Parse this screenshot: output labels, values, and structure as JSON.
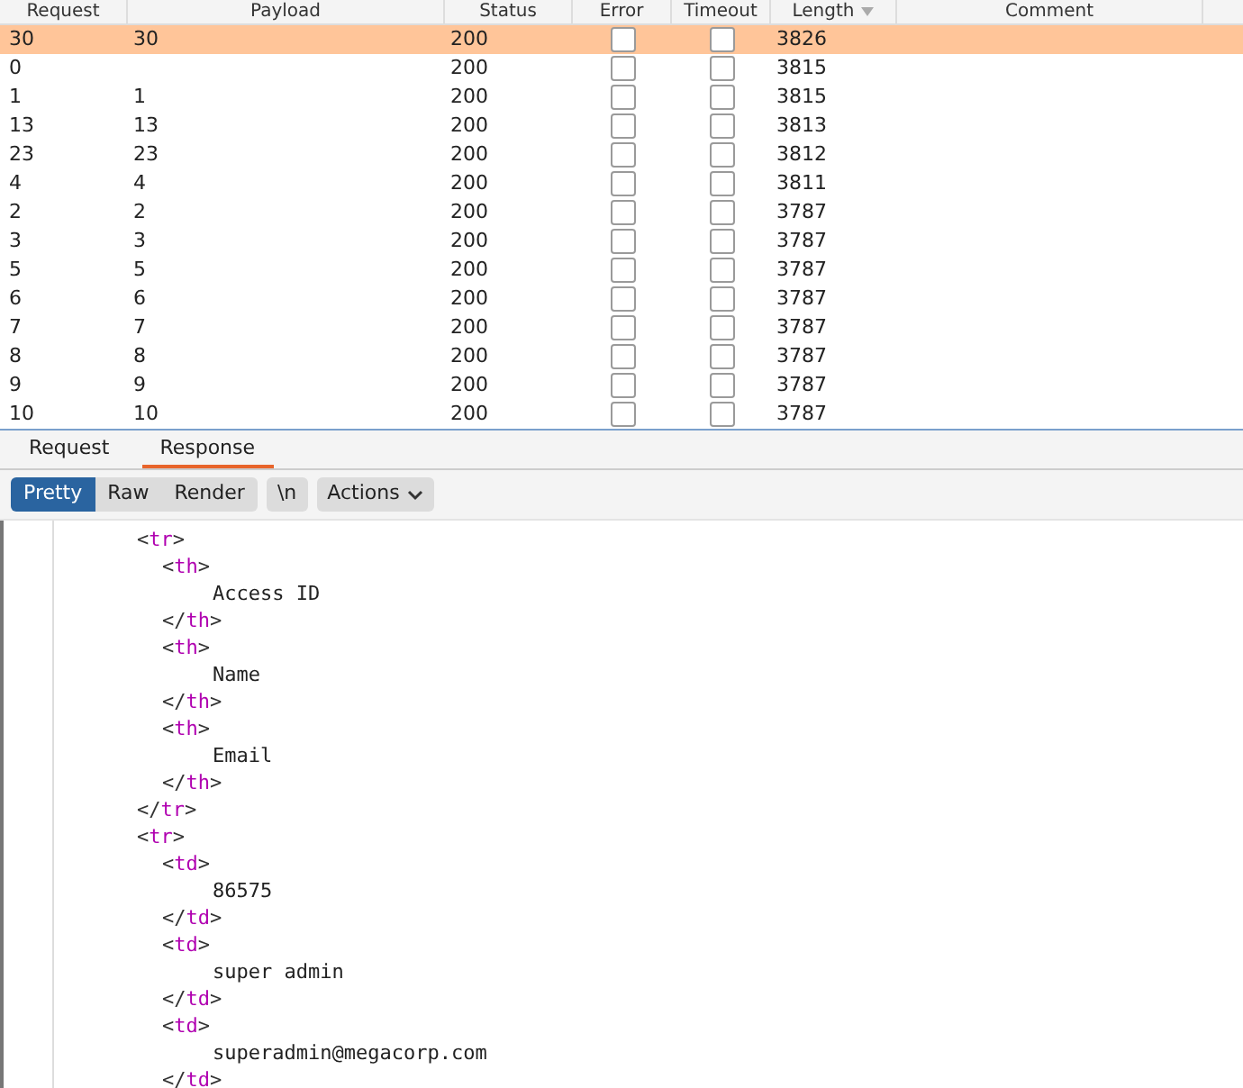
{
  "table": {
    "columns": [
      "Request",
      "Payload",
      "Status",
      "Error",
      "Timeout",
      "Length",
      "Comment"
    ],
    "rows": [
      {
        "request": "30",
        "payload": "30",
        "status": "200",
        "error": false,
        "timeout": false,
        "length": "3826",
        "selected": true
      },
      {
        "request": "0",
        "payload": "",
        "status": "200",
        "error": false,
        "timeout": false,
        "length": "3815",
        "selected": false
      },
      {
        "request": "1",
        "payload": "1",
        "status": "200",
        "error": false,
        "timeout": false,
        "length": "3815",
        "selected": false
      },
      {
        "request": "13",
        "payload": "13",
        "status": "200",
        "error": false,
        "timeout": false,
        "length": "3813",
        "selected": false
      },
      {
        "request": "23",
        "payload": "23",
        "status": "200",
        "error": false,
        "timeout": false,
        "length": "3812",
        "selected": false
      },
      {
        "request": "4",
        "payload": "4",
        "status": "200",
        "error": false,
        "timeout": false,
        "length": "3811",
        "selected": false
      },
      {
        "request": "2",
        "payload": "2",
        "status": "200",
        "error": false,
        "timeout": false,
        "length": "3787",
        "selected": false
      },
      {
        "request": "3",
        "payload": "3",
        "status": "200",
        "error": false,
        "timeout": false,
        "length": "3787",
        "selected": false
      },
      {
        "request": "5",
        "payload": "5",
        "status": "200",
        "error": false,
        "timeout": false,
        "length": "3787",
        "selected": false
      },
      {
        "request": "6",
        "payload": "6",
        "status": "200",
        "error": false,
        "timeout": false,
        "length": "3787",
        "selected": false
      },
      {
        "request": "7",
        "payload": "7",
        "status": "200",
        "error": false,
        "timeout": false,
        "length": "3787",
        "selected": false
      },
      {
        "request": "8",
        "payload": "8",
        "status": "200",
        "error": false,
        "timeout": false,
        "length": "3787",
        "selected": false
      },
      {
        "request": "9",
        "payload": "9",
        "status": "200",
        "error": false,
        "timeout": false,
        "length": "3787",
        "selected": false
      },
      {
        "request": "10",
        "payload": "10",
        "status": "200",
        "error": false,
        "timeout": false,
        "length": "3787",
        "selected": false
      }
    ]
  },
  "tabs": [
    {
      "label": "Request",
      "selected": false
    },
    {
      "label": "Response",
      "selected": true
    }
  ],
  "view_buttons": [
    {
      "label": "Pretty",
      "selected": true
    },
    {
      "label": "Raw",
      "selected": false
    },
    {
      "label": "Render",
      "selected": false
    }
  ],
  "newline_button": "\\n",
  "actions_button": "Actions",
  "code": [
    {
      "open": "<tr>",
      "close": "</tr>",
      "children": [
        {
          "open": "<th>",
          "close": "</th>",
          "children": [
            {
              "text": "Access ID"
            }
          ]
        },
        {
          "open": "<th>",
          "close": "</th>",
          "children": [
            {
              "text": "Name"
            }
          ]
        },
        {
          "open": "<th>",
          "close": "</th>",
          "children": [
            {
              "text": "Email"
            }
          ]
        }
      ]
    },
    {
      "open": "<tr>",
      "children": [
        {
          "open": "<td>",
          "close": "</td>",
          "children": [
            {
              "text": "86575"
            }
          ]
        },
        {
          "open": "<td>",
          "close": "</td>",
          "children": [
            {
              "text": "super admin"
            }
          ]
        },
        {
          "open": "<td>",
          "close": "</td>",
          "children": [
            {
              "text": "superadmin@megacorp.com"
            }
          ]
        }
      ]
    }
  ]
}
